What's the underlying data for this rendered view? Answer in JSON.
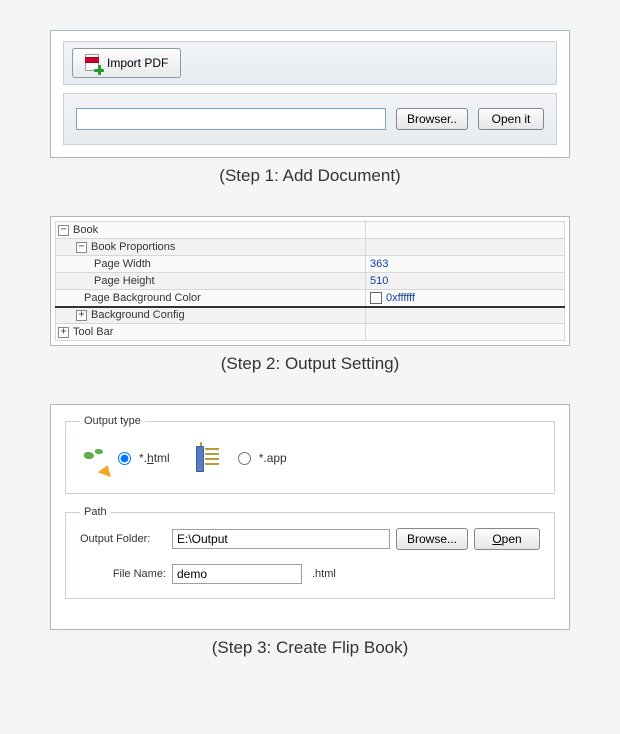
{
  "step1": {
    "import_label": "Import PDF",
    "file_path_value": "",
    "browser_btn": "Browser..",
    "open_btn": "Open it",
    "caption": "(Step 1: Add Document)"
  },
  "step2": {
    "rows": {
      "book": "Book",
      "book_proportions": "Book Proportions",
      "page_width": "Page Width",
      "page_width_val": "363",
      "page_height": "Page Height",
      "page_height_val": "510",
      "page_bg_color": "Page Background Color",
      "page_bg_color_val": "0xffffff",
      "bg_config": "Background Config",
      "tool_bar": "Tool Bar"
    },
    "caption": "(Step 2: Output Setting)"
  },
  "step3": {
    "output_type_legend": "Output type",
    "html_label_prefix": "*.",
    "html_label_u": "h",
    "html_label_suffix": "tml",
    "app_label": "*.app",
    "path_legend": "Path",
    "output_folder_label": "Output Folder:",
    "output_folder_value": "E:\\Output",
    "browse_btn": "Browse...",
    "open_btn_prefix": "",
    "open_btn_u": "O",
    "open_btn_suffix": "pen",
    "file_name_label": "File Name:",
    "file_name_value": "demo",
    "ext_label": ".html",
    "caption": "(Step 3: Create Flip Book)"
  }
}
